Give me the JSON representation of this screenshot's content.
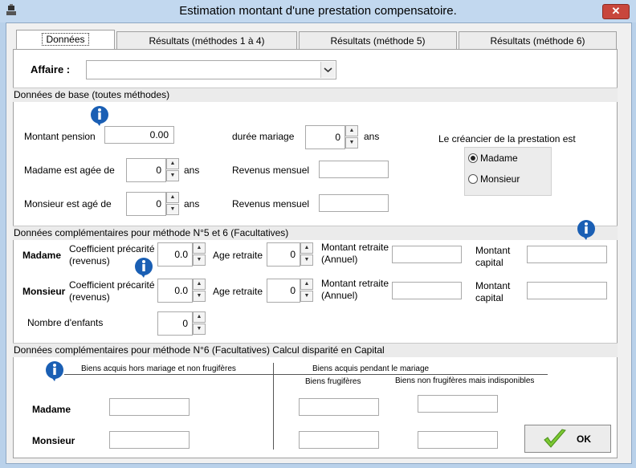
{
  "window": {
    "title": "Estimation montant d'une prestation compensatoire.",
    "close_glyph": "✕"
  },
  "tabs": [
    {
      "label": "Données",
      "active": true
    },
    {
      "label": "Résultats (méthodes 1 à 4)",
      "active": false
    },
    {
      "label": "Résultats (méthode 5)",
      "active": false
    },
    {
      "label": "Résultats (méthode 6)",
      "active": false
    }
  ],
  "affaire": {
    "label": "Affaire :",
    "value": ""
  },
  "base": {
    "section_title": "Données de base (toutes méthodes)",
    "montant_pension_label": "Montant pension",
    "montant_pension_value": "0.00",
    "duree_mariage_label": "durée mariage",
    "duree_mariage_value": "0",
    "ans": "ans",
    "madame_age_label": "Madame est agée de",
    "madame_age_value": "0",
    "monsieur_age_label": "Monsieur est agé de",
    "monsieur_age_value": "0",
    "revenus_label": "Revenus mensuel",
    "revenus_madame": "",
    "revenus_monsieur": "",
    "creancier_label": "Le créancier de la prestation est",
    "options": [
      "Madame",
      "Monsieur"
    ],
    "selected": "Madame"
  },
  "comp5": {
    "section_title": "Données complémentaires pour méthode N°5  et 6 (Facultatives)",
    "madame": "Madame",
    "monsieur": "Monsieur",
    "coef_label_1": "Coefficient précarité",
    "coef_label_2": "(revenus)",
    "coef_madame": "0.0",
    "coef_monsieur": "0.0",
    "age_retraite_label": "Age retraite",
    "age_retraite_madame": "0",
    "age_retraite_monsieur": "0",
    "montant_retraite_1": "Montant retraite",
    "montant_retraite_2": "(Annuel)",
    "montant_capital_1": "Montant",
    "montant_capital_2": "capital",
    "nb_enfants_label": "Nombre d'enfants",
    "nb_enfants_value": "0"
  },
  "comp6": {
    "section_title": "Données complémentaires pour méthode N°6  (Facultatives)  Calcul disparité en Capital",
    "hors_mariage": "Biens acquis hors mariage et  non frugifères",
    "pendant_mariage": "Biens acquis pendant le mariage",
    "frugiferes": "Biens frugifères",
    "non_frugiferes": "Biens non frugifères mais indisponibles",
    "madame": "Madame",
    "monsieur": "Monsieur"
  },
  "ok_button": {
    "label": "OK"
  },
  "colors": {
    "accent_check": "#7cc832",
    "info_blue": "#1a5fb4",
    "section_bg": "#ebebeb"
  }
}
